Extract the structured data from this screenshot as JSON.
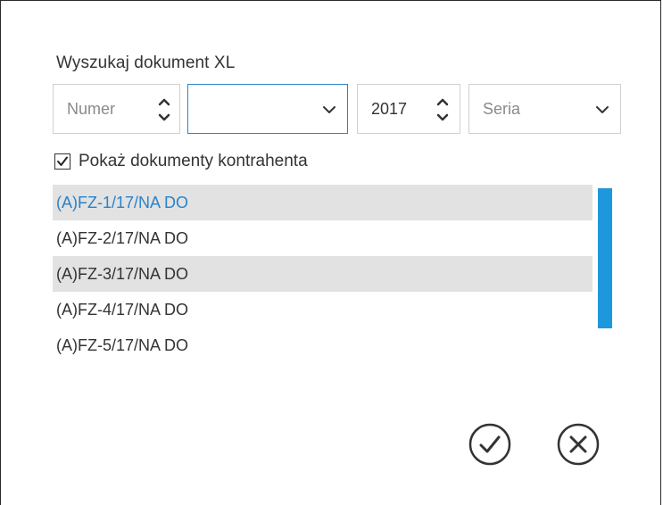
{
  "dialog": {
    "title": "Wyszukaj dokument XL"
  },
  "filters": {
    "number": {
      "placeholder": "Numer"
    },
    "type": {
      "value": ""
    },
    "year": {
      "value": "2017"
    },
    "series": {
      "placeholder": "Seria"
    }
  },
  "show_contractor_docs": {
    "label": "Pokaż dokumenty kontrahenta",
    "checked": true
  },
  "documents": [
    {
      "label": "(A)FZ-1/17/NA DO",
      "shaded": true,
      "selected": true
    },
    {
      "label": "(A)FZ-2/17/NA DO",
      "shaded": false,
      "selected": false
    },
    {
      "label": "(A)FZ-3/17/NA DO",
      "shaded": true,
      "selected": false
    },
    {
      "label": "(A)FZ-4/17/NA DO",
      "shaded": false,
      "selected": false
    },
    {
      "label": "(A)FZ-5/17/NA DO",
      "shaded": false,
      "selected": false
    }
  ],
  "colors": {
    "accent": "#2b82c8",
    "scrollbar": "#1f97dd",
    "row_shade": "#e2e2e2",
    "text": "#333333"
  },
  "buttons": {
    "confirm_icon": "check-circle-icon",
    "cancel_icon": "close-circle-icon"
  }
}
